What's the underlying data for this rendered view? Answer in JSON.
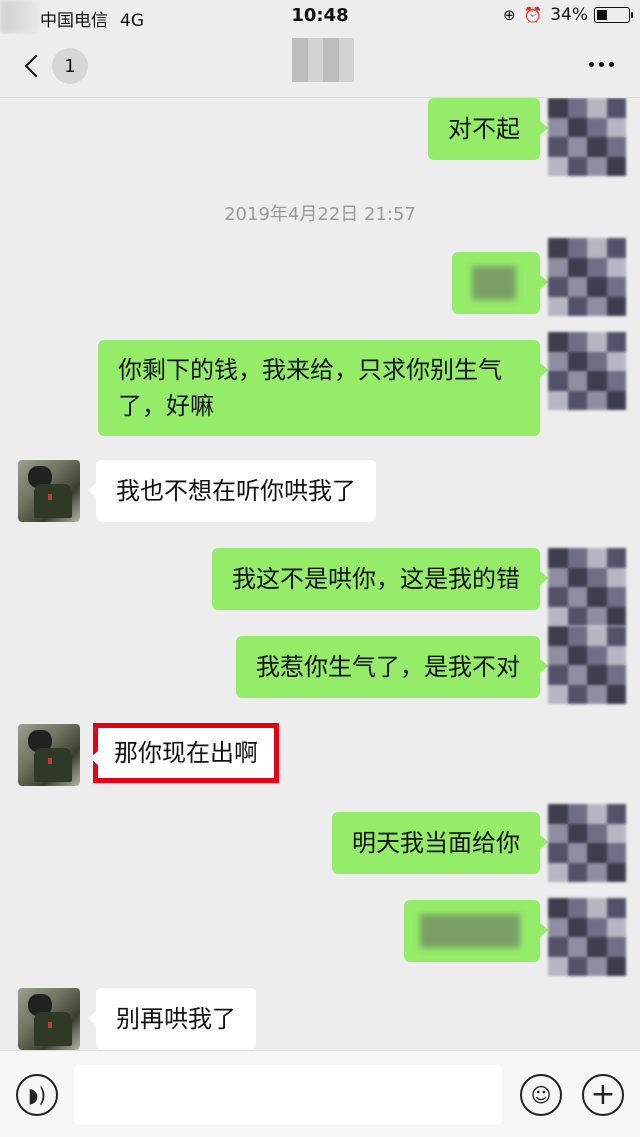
{
  "status_bar": {
    "carrier": "中国电信",
    "network": "4G",
    "time": "10:48",
    "battery_percent": "34%",
    "icons": [
      "orientation-lock-icon",
      "alarm-icon",
      "battery-icon"
    ]
  },
  "nav": {
    "unread_count": "1",
    "icons": [
      "back-chevron-icon",
      "more-icon"
    ]
  },
  "chat": {
    "timestamp": "2019年4月22日  21:57",
    "messages": [
      {
        "side": "me",
        "text": "对不起"
      },
      {
        "side": "me",
        "text": ""
      },
      {
        "side": "me",
        "text": "你剩下的钱，我来给，只求你别生气了，好嘛"
      },
      {
        "side": "them",
        "text": "我也不想在听你哄我了"
      },
      {
        "side": "me",
        "text": "我这不是哄你，这是我的错"
      },
      {
        "side": "me",
        "text": "我惹你生气了，是我不对"
      },
      {
        "side": "them",
        "text": "那你现在出啊"
      },
      {
        "side": "me",
        "text": "明天我当面给你"
      },
      {
        "side": "me",
        "text": ""
      },
      {
        "side": "them",
        "text": "别再哄我了"
      }
    ]
  },
  "input_bar": {
    "icons": [
      "voice-icon",
      "emoji-icon",
      "plus-icon"
    ]
  },
  "colors": {
    "background": "#ededed",
    "my_bubble": "#95ec69",
    "their_bubble": "#ffffff",
    "highlight_box": "#e60012"
  }
}
